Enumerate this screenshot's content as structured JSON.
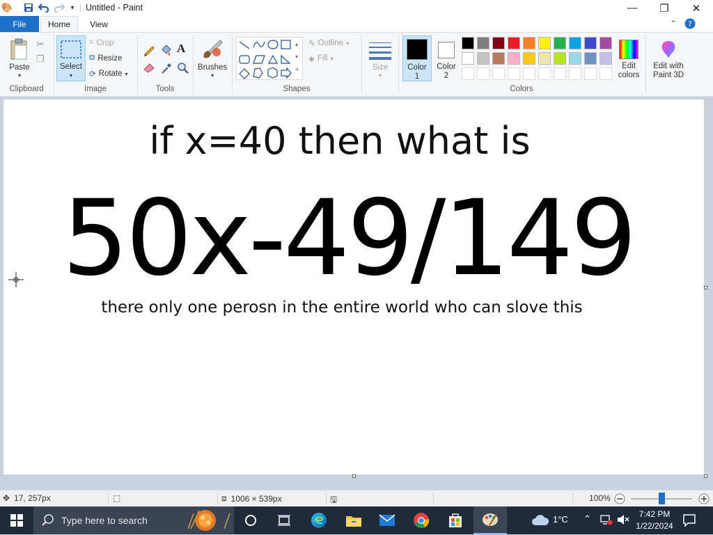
{
  "window": {
    "title": "Untitled - Paint",
    "buttons": {
      "minimize": "—",
      "maximize": "❐",
      "close": "✕"
    }
  },
  "tabs": {
    "file": "File",
    "home": "Home",
    "view": "View"
  },
  "ribbon": {
    "clipboard": {
      "paste": "Paste",
      "label": "Clipboard"
    },
    "image": {
      "select": "Select",
      "crop": "Crop",
      "resize": "Resize",
      "rotate": "Rotate",
      "label": "Image"
    },
    "tools": {
      "label": "Tools"
    },
    "brushes": {
      "label": "Brushes"
    },
    "shapes": {
      "outline": "Outline",
      "fill": "Fill",
      "label": "Shapes"
    },
    "size": {
      "label": "Size"
    },
    "colors": {
      "color1": "Color",
      "color1_num": "1",
      "color2": "Color",
      "color2_num": "2",
      "edit_colors_1": "Edit",
      "edit_colors_2": "colors",
      "edit_paint3d_1": "Edit with",
      "edit_paint3d_2": "Paint 3D",
      "label": "Colors",
      "color1_value": "#000000",
      "color2_value": "#ffffff",
      "palette_row1": [
        "#000000",
        "#7f7f7f",
        "#880015",
        "#ed1c24",
        "#ff7f27",
        "#fff200",
        "#22b14c",
        "#00a2e8",
        "#3f48cc",
        "#a349a4"
      ],
      "palette_row2": [
        "#ffffff",
        "#c3c3c3",
        "#b97a57",
        "#ffaec9",
        "#ffc90e",
        "#efe4b0",
        "#b5e61d",
        "#99d9ea",
        "#7092be",
        "#c8bfe7"
      ]
    }
  },
  "canvas": {
    "line1": "if x=40 then what is",
    "line2": "50x-49/149",
    "line3": "there only one perosn in the entire world who can slove this"
  },
  "status": {
    "cursor_pos": "17, 257px",
    "canvas_size": "1006 × 539px",
    "zoom": "100%",
    "zoom_level": 1.0
  },
  "taskbar": {
    "search_placeholder": "Type here to search",
    "weather": "1°C",
    "time": "7:42 PM",
    "date": "1/22/2024"
  }
}
